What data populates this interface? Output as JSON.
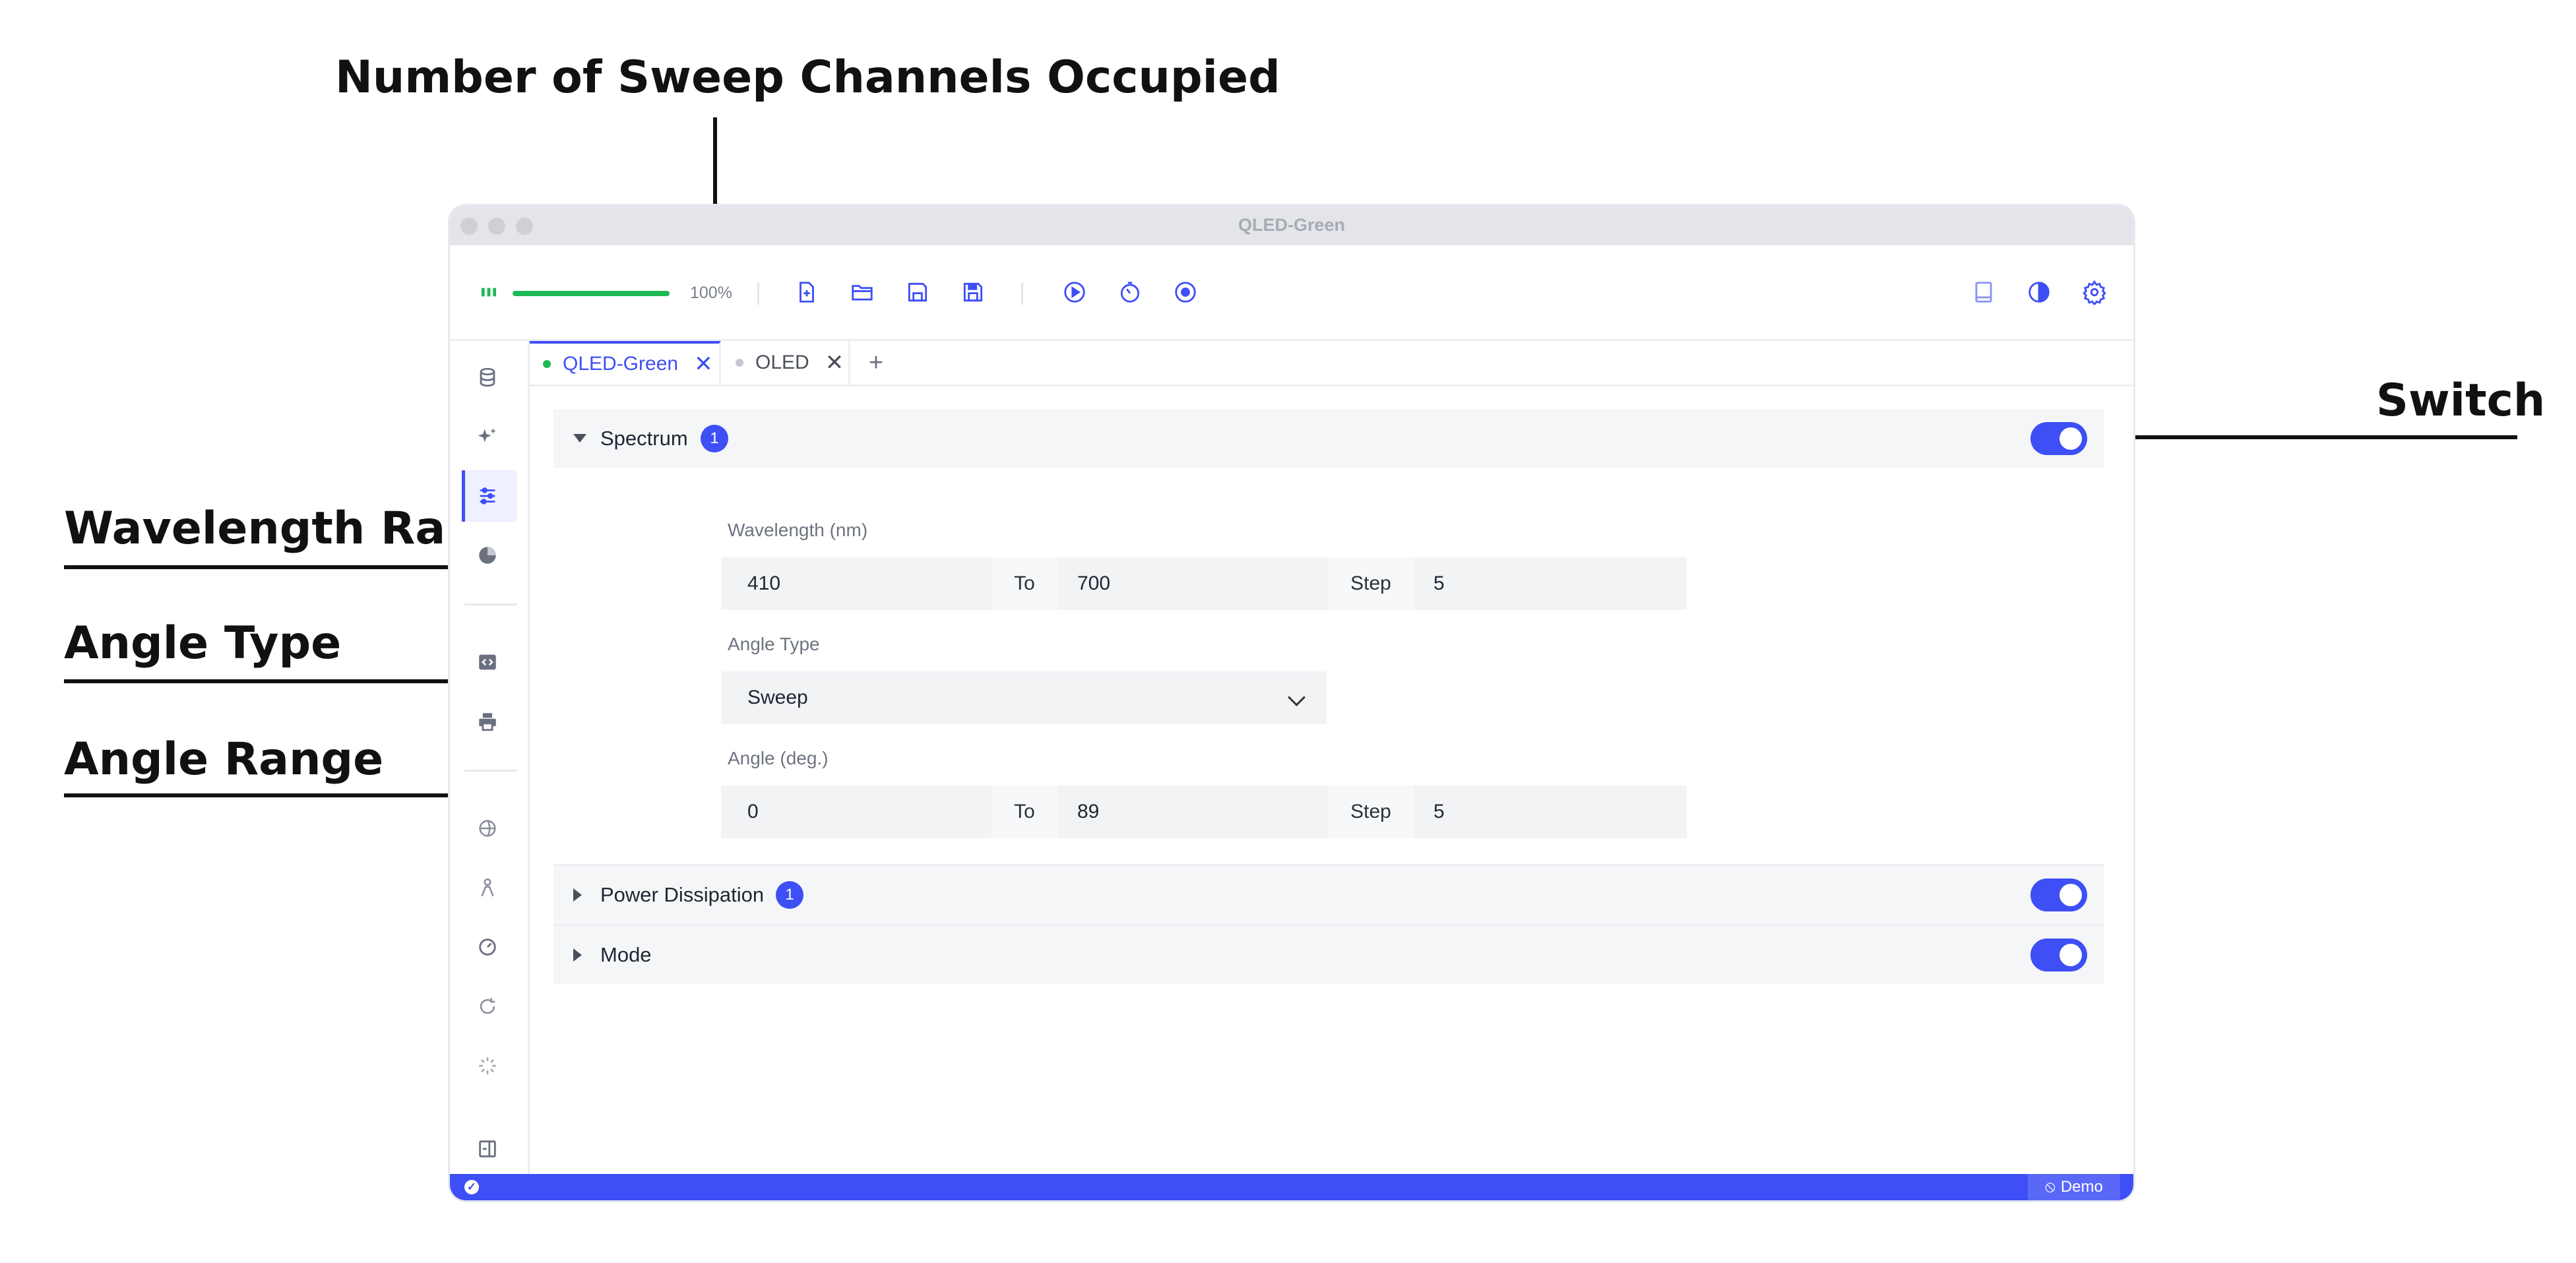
{
  "annotations": {
    "sweep_channels": "Number of Sweep Channels Occupied",
    "switch": "Switch",
    "wavelength_range": "Wavelength Range",
    "angle_type": "Angle Type",
    "angle_range": "Angle Range"
  },
  "window": {
    "title": "QLED-Green"
  },
  "toolbar": {
    "progress_value": 1.0,
    "progress_text": "100%",
    "icons": [
      "bars-icon",
      "new-file-icon",
      "open-folder-icon",
      "save-icon",
      "save-as-icon",
      "play-icon",
      "timer-icon",
      "stop-icon",
      "book-icon",
      "theme-icon",
      "gear-icon"
    ]
  },
  "sidebar": {
    "icons": [
      "database-icon",
      "sparkle-icon",
      "sliders-icon",
      "pie-icon",
      "code-icon",
      "print-icon",
      "globe-icon",
      "person-icon",
      "gauge-icon",
      "refresh-icon",
      "loader-icon",
      "panel-icon"
    ]
  },
  "tabs": [
    {
      "label": "QLED-Green",
      "active": true,
      "dot_color": "#1db954"
    },
    {
      "label": "OLED",
      "active": false,
      "dot_color": "#c4c7ce"
    }
  ],
  "tab_add": "+",
  "tab_close": "✕",
  "panels": {
    "spectrum": {
      "title": "Spectrum",
      "badge": "1",
      "enabled": true,
      "wavelength": {
        "label": "Wavelength (nm)",
        "from": "410",
        "to_label": "To",
        "to": "700",
        "step_label": "Step",
        "step": "5"
      },
      "angle_type": {
        "label": "Angle Type",
        "value": "Sweep"
      },
      "angle": {
        "label": "Angle (deg.)",
        "from": "0",
        "to_label": "To",
        "to": "89",
        "step_label": "Step",
        "step": "5"
      }
    },
    "power": {
      "title": "Power Dissipation",
      "badge": "1",
      "enabled": true
    },
    "mode": {
      "title": "Mode",
      "enabled": true
    }
  },
  "status": {
    "demo": "Demo",
    "demo_icon": "no-entry-icon",
    "check_icon": "check-circle-icon"
  },
  "colors": {
    "accent": "#3e4ff5",
    "progress": "#1db954"
  }
}
